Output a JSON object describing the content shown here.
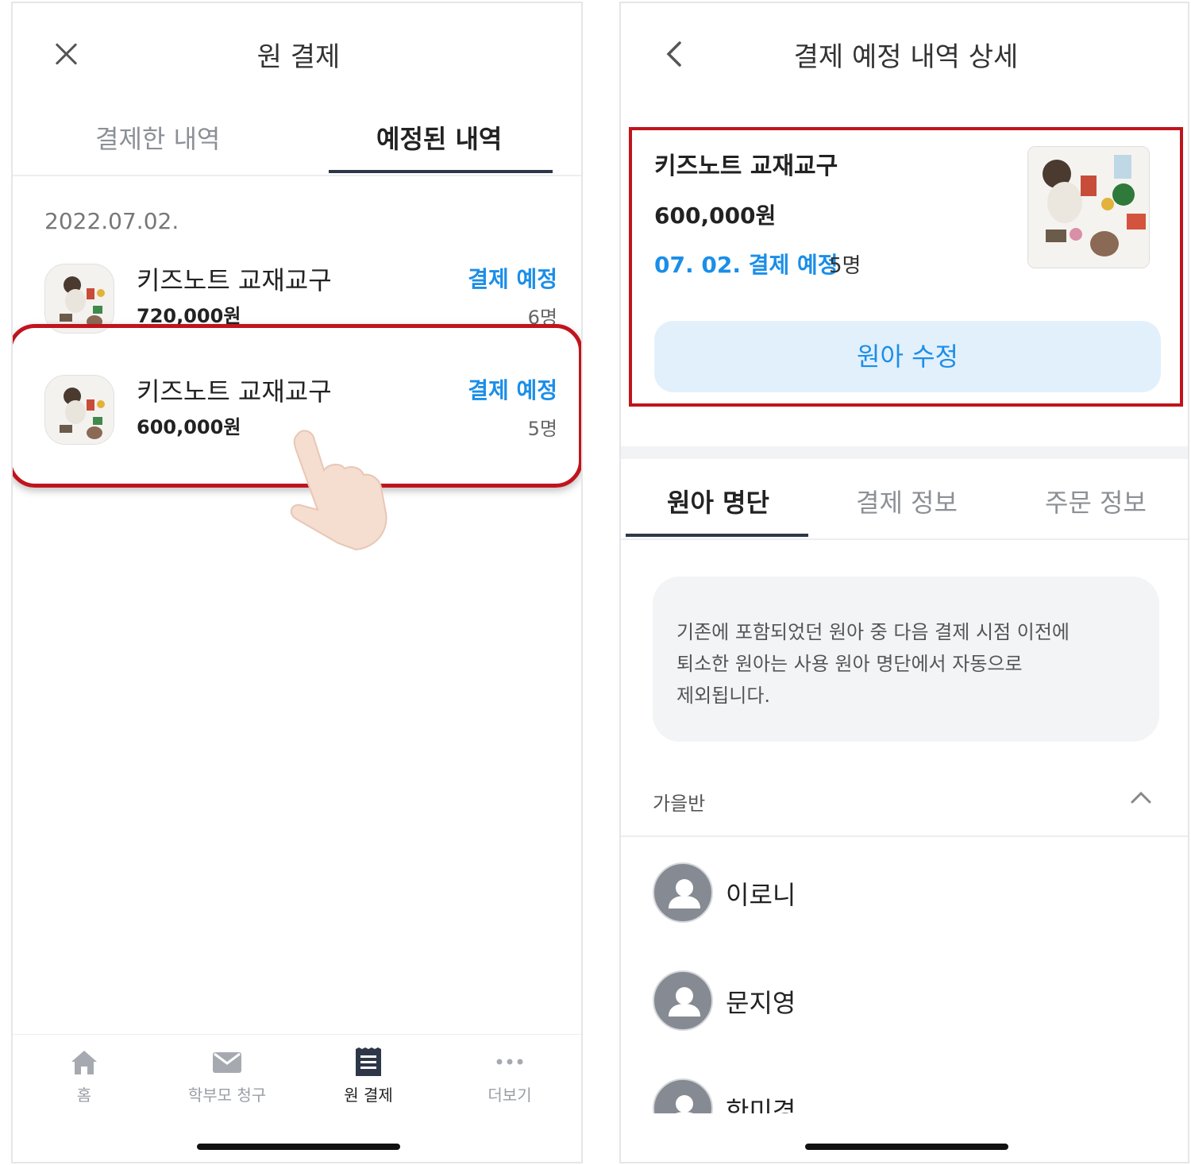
{
  "left": {
    "title": "원 결제",
    "tabs": [
      {
        "label": "결제한 내역",
        "active": false
      },
      {
        "label": "예정된 내역",
        "active": true
      }
    ],
    "date": "2022.07.02.",
    "items": [
      {
        "name": "키즈노트 교재교구",
        "price": "720,000원",
        "status": "결제 예정",
        "count": "6명"
      },
      {
        "name": "키즈노트 교재교구",
        "price": "600,000원",
        "status": "결제 예정",
        "count": "5명"
      }
    ],
    "bottom_nav": [
      {
        "label": "홈",
        "icon": "home-icon"
      },
      {
        "label": "학부모 청구",
        "icon": "mail-icon"
      },
      {
        "label": "원 결제",
        "icon": "receipt-icon",
        "active": true
      },
      {
        "label": "더보기",
        "icon": "more-icon"
      }
    ]
  },
  "right": {
    "title": "결제 예정 내역 상세",
    "detail": {
      "name": "키즈노트 교재교구",
      "price": "600,000원",
      "date_status": "07. 02. 결제 예정",
      "count": "5명",
      "edit_button": "원아 수정"
    },
    "tabs": [
      {
        "label": "원아 명단",
        "active": true
      },
      {
        "label": "결제 정보",
        "active": false
      },
      {
        "label": "주문 정보",
        "active": false
      }
    ],
    "notice_lines": [
      "기존에 포함되었던 원아 중 다음 결제 시점 이전에",
      "퇴소한 원아는 사용 원아 명단에서 자동으로",
      "제외됩니다."
    ],
    "class_name": "가을반",
    "members": [
      "이로니",
      "문지영",
      "한미경"
    ]
  },
  "colors": {
    "accent_blue": "#1b8ee8",
    "highlight_red": "#c0141c",
    "tab_underline": "#2e3748"
  }
}
